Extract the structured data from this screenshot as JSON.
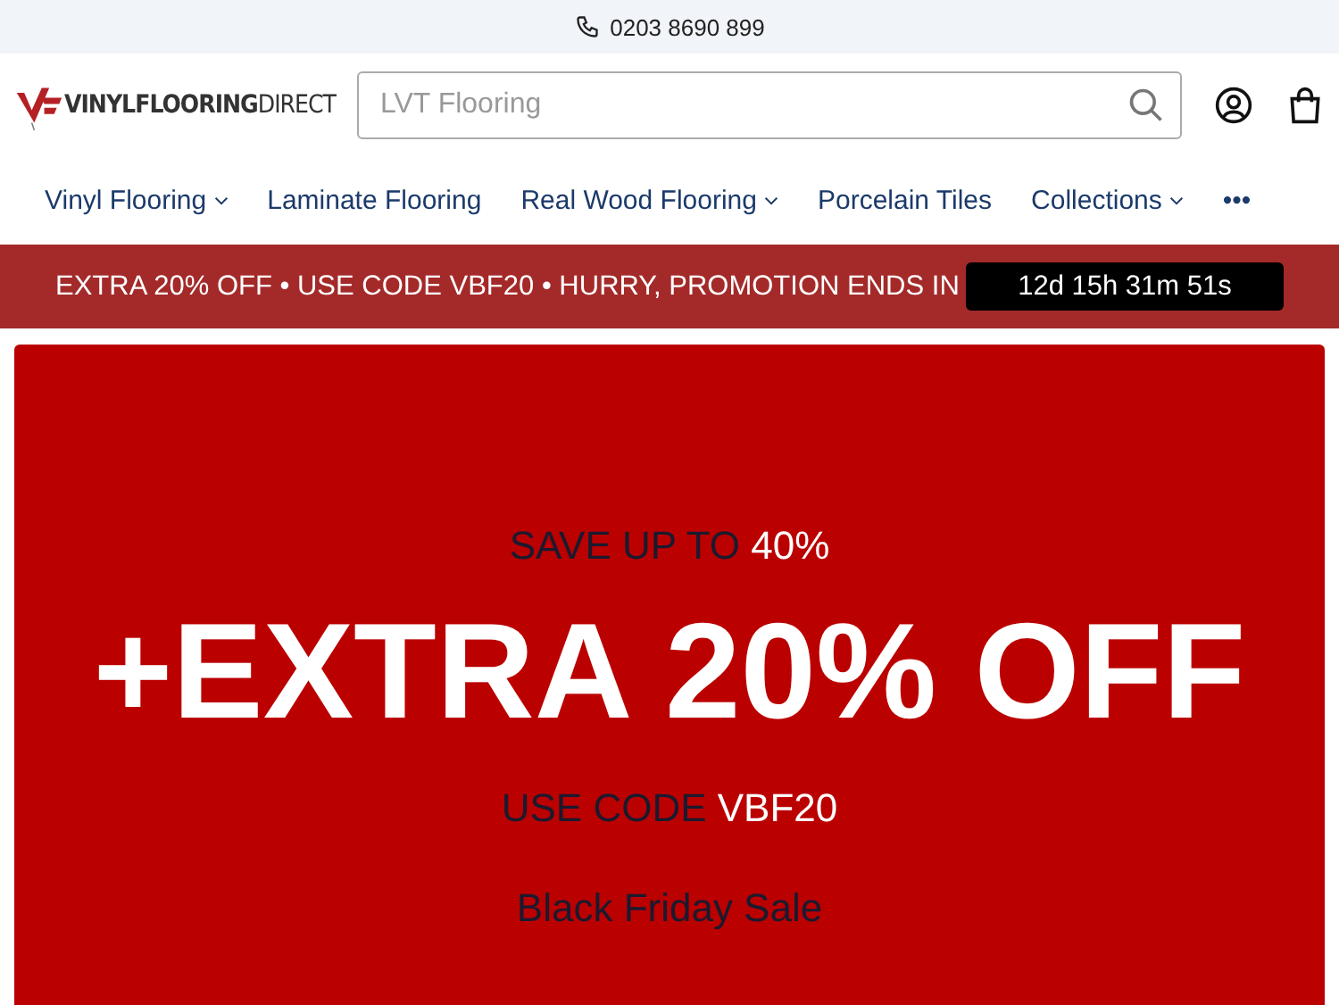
{
  "top_bar": {
    "phone": "0203 8690 899"
  },
  "header": {
    "logo": "**VINYLFLOORING**DIRECT",
    "search": {
      "placeholder": "LVT Flooring"
    }
  },
  "nav": [
    {
      "label": "Vinyl Flooring",
      "has_dropdown": true
    },
    {
      "label": "Laminate Flooring",
      "has_dropdown": false
    },
    {
      "label": "Real Wood Flooring",
      "has_dropdown": true
    },
    {
      "label": "Porcelain Tiles",
      "has_dropdown": false
    },
    {
      "label": "Collections",
      "has_dropdown": true
    },
    {
      "label": "•••",
      "has_dropdown": false
    }
  ],
  "promo_bar": {
    "text": "EXTRA 20% OFF • USE CODE VBF20 • HURRY, PROMOTION ENDS IN",
    "countdown": "12d 15h 31m 51s"
  },
  "hero": {
    "lines": [
      {
        "kind": "sub",
        "text": "SAVE UP TO",
        "highlight": "40%"
      },
      {
        "kind": "headline",
        "text": "+EXTRA 20% OFF"
      },
      {
        "kind": "sub",
        "text": "USE CODE",
        "highlight": "VBF20"
      },
      {
        "kind": "tagline",
        "text": "Black Friday Sale"
      }
    ]
  }
}
